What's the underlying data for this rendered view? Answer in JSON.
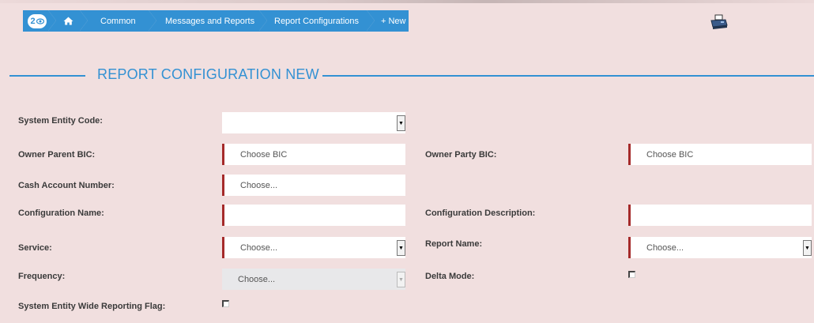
{
  "breadcrumb": {
    "badge_count": "2",
    "items": [
      "Common",
      "Messages and Reports",
      "Report Configurations"
    ],
    "new_label": "+ New"
  },
  "section_title": "REPORT CONFIGURATION NEW",
  "form": {
    "system_entity_code": {
      "label": "System Entity Code:",
      "value": ""
    },
    "owner_parent_bic": {
      "label": "Owner Parent BIC:",
      "placeholder": "Choose BIC"
    },
    "owner_party_bic": {
      "label": "Owner Party BIC:",
      "placeholder": "Choose BIC"
    },
    "cash_account_number": {
      "label": "Cash Account Number:",
      "placeholder": "Choose..."
    },
    "configuration_name": {
      "label": "Configuration Name:",
      "value": ""
    },
    "configuration_description": {
      "label": "Configuration Description:",
      "value": ""
    },
    "service": {
      "label": "Service:",
      "value": "Choose..."
    },
    "report_name": {
      "label": "Report Name:",
      "value": "Choose..."
    },
    "frequency": {
      "label": "Frequency:",
      "value": "Choose..."
    },
    "delta_mode": {
      "label": "Delta Mode:",
      "checked": false
    },
    "system_entity_wide_reporting_flag": {
      "label": "System Entity Wide Reporting Flag:",
      "checked": false
    }
  },
  "icons": {
    "eye": "eye-icon",
    "home": "home-icon",
    "print": "printer-icon",
    "dropdown": "chevron-down-icon"
  },
  "colors": {
    "accent": "#3391d3",
    "background": "#f1dfdf",
    "required_marker": "#a52a2a"
  }
}
